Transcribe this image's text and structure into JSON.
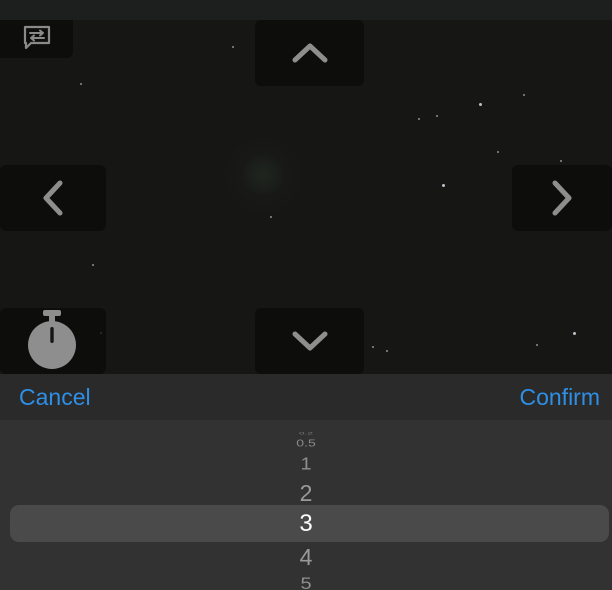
{
  "icons": {
    "chat": "chat-swap-icon",
    "up": "chevron-up-icon",
    "down": "chevron-down-icon",
    "left": "chevron-left-icon",
    "right": "chevron-right-icon",
    "timer": "stopwatch-icon"
  },
  "sheet": {
    "cancel_label": "Cancel",
    "confirm_label": "Confirm"
  },
  "picker": {
    "options": [
      "0.2",
      "0.5",
      "1",
      "2",
      "3",
      "4",
      "5"
    ],
    "selected": "3"
  },
  "colors": {
    "accent": "#2e8fe6",
    "sheet_header": "#2a2a2a",
    "picker_bg": "#323232",
    "highlight": "#4a4a4a"
  }
}
